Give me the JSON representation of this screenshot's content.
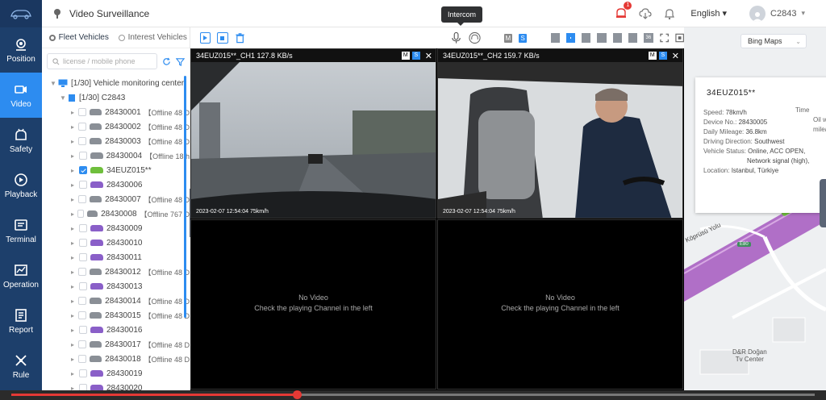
{
  "header": {
    "title": "Video Surveillance",
    "alarm_count": "1",
    "language": "English",
    "user": "C2843"
  },
  "nav": {
    "items": [
      {
        "label": "Position",
        "icon": "position-icon"
      },
      {
        "label": "Video",
        "icon": "video-camera-icon",
        "active": true
      },
      {
        "label": "Safety",
        "icon": "safety-icon"
      },
      {
        "label": "Playback",
        "icon": "playback-icon"
      },
      {
        "label": "Terminal",
        "icon": "terminal-icon"
      },
      {
        "label": "Operation",
        "icon": "operation-icon"
      },
      {
        "label": "Report",
        "icon": "report-icon"
      },
      {
        "label": "Rule",
        "icon": "rule-icon"
      }
    ]
  },
  "vehicles": {
    "tabs": [
      "Fleet Vehicles",
      "Interest Vehicles"
    ],
    "search_placeholder": "license / mobile phone",
    "group": "[1/30] Vehicle monitoring center",
    "subgroup": "[1/30] C2843",
    "list": [
      {
        "id": "28430001",
        "status": "【Offline 48 D",
        "color": "gray"
      },
      {
        "id": "28430002",
        "status": "【Offline 48 D",
        "color": "gray"
      },
      {
        "id": "28430003",
        "status": "【Offline 48 D",
        "color": "gray"
      },
      {
        "id": "28430004",
        "status": "【Offline 18 h",
        "color": "gray"
      },
      {
        "id": "34EUZ015**",
        "status": "",
        "color": "green",
        "checked": true
      },
      {
        "id": "28430006",
        "status": "",
        "color": "purple"
      },
      {
        "id": "28430007",
        "status": "【Offline 48 D",
        "color": "gray"
      },
      {
        "id": "28430008",
        "status": "【Offline 767 D",
        "color": "gray"
      },
      {
        "id": "28430009",
        "status": "",
        "color": "purple"
      },
      {
        "id": "28430010",
        "status": "",
        "color": "purple"
      },
      {
        "id": "28430011",
        "status": "",
        "color": "purple"
      },
      {
        "id": "28430012",
        "status": "【Offline 48 D",
        "color": "gray"
      },
      {
        "id": "28430013",
        "status": "",
        "color": "purple"
      },
      {
        "id": "28430014",
        "status": "【Offline 48 D",
        "color": "gray"
      },
      {
        "id": "28430015",
        "status": "【Offline 48 D",
        "color": "gray"
      },
      {
        "id": "28430016",
        "status": "",
        "color": "purple"
      },
      {
        "id": "28430017",
        "status": "【Offline 48 D",
        "color": "gray"
      },
      {
        "id": "28430018",
        "status": "【Offline 48 D",
        "color": "gray"
      },
      {
        "id": "28430019",
        "status": "",
        "color": "purple"
      },
      {
        "id": "28430020",
        "status": "",
        "color": "purple"
      }
    ]
  },
  "toolbar": {
    "tooltip": "Intercom",
    "m_label": "M",
    "s_label": "S",
    "grid_36": "36"
  },
  "video": {
    "ch1_title": "34EUZ015**_CH1 127.8 KB/s",
    "ch2_title": "34EUZ015**_CH2 159.7 KB/s",
    "ch1_stamp": "2023-02-07 12:54:04  75km/h",
    "ch2_stamp": "2023-02-07 12:54:04  75km/h",
    "m": "M",
    "s": "S",
    "no_video": "No Video",
    "no_video_hint": "Check the playing Channel in the left"
  },
  "map": {
    "provider": "Bing Maps",
    "card": {
      "plate": "34EUZ015**",
      "speed": "78km/h",
      "device_no": "28430005",
      "daily_mileage": "36.8km",
      "direction": "Southwest",
      "status": "Online,  ACC OPEN,",
      "status2": "Network signal (high),",
      "location": "Istanbul, Türkiye",
      "k_speed": "Speed:",
      "k_device": "Device No.:",
      "k_mileage": "Daily Mileage:",
      "k_direction": "Driving Direction:",
      "k_status": "Vehicle Status:",
      "k_location": "Location:",
      "k_time": "Time",
      "k_oil": "Oil w",
      "k_milea": "milea"
    },
    "poi": "D&R Doğan\nTv Center",
    "road1": "Köprüsü Yolu",
    "road_badge": "E80"
  },
  "progress": {
    "fraction": 0.355
  }
}
